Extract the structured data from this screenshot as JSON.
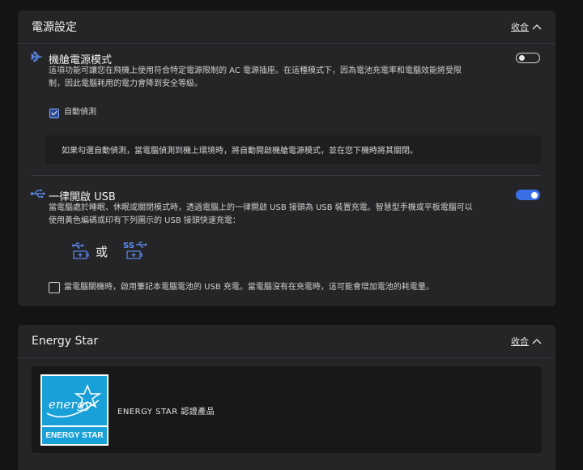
{
  "power": {
    "title": "電源設定",
    "collapse_label": "收合",
    "airplane": {
      "title": "機艙電源模式",
      "desc_line1": "這項功能可讓您在飛機上使用符合特定電源限制的 AC 電源插座。在這種模式下，因為電池充電率和電腦效能將受限",
      "desc_line2": "制，因此電腦耗用的電力會降到安全等級。",
      "toggle_on": false,
      "auto_detect_label": "自動偵測",
      "auto_detect_checked": true,
      "note": "如果勾選自動偵測，當電腦偵測到機上環境時，將自動開啟機艙電源模式，並在您下機時將其關閉。",
      "icon": "airplane-icon"
    },
    "usb": {
      "title": "一律開啟 USB",
      "desc_line1": "當電腦處於睡眠、休眠或關閉模式時，透過電腦上的一律開啟 USB 接頭為 USB 裝置充電。智慧型手機或平板電腦可以",
      "desc_line2": "使用黃色編碼或印有下列圖示的 USB 接頭快速充電：",
      "toggle_on": true,
      "or_label": "或",
      "battery_checkbox_label": "當電腦關機時，啟用筆記本電腦電池的 USB 充電。當電腦沒有在充電時，這可能會增加電池的耗電量。",
      "battery_checked": false,
      "icon": "usb-icon",
      "accent": "#3a6fe6"
    }
  },
  "energy": {
    "title": "Energy Star",
    "collapse_label": "收合",
    "logo_script": "energy",
    "logo_band": "ENERGY STAR",
    "product_label": "ENERGY STAR 認證產品",
    "brand_color": "#1aa0d8"
  }
}
